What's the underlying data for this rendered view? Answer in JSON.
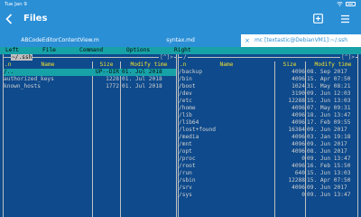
{
  "status": {
    "time": "Tue Jan 9"
  },
  "nav": {
    "title": "Files"
  },
  "tabs": [
    {
      "label": "ABCodeEditorContentView.m"
    },
    {
      "label": "syntax.md"
    },
    {
      "label": "mc [textastic@DebianVM1]:~/.ssh",
      "close": "×"
    }
  ],
  "mc": {
    "menu": [
      "Left",
      "File",
      "Command",
      "Options",
      "Right"
    ],
    "left": {
      "path": "~/.ssh",
      "corner": "[^]>",
      "header": {
        "sort": ".n",
        "name": "Name",
        "size": "Size",
        "time": "Modify time"
      },
      "rows": [
        {
          "name": "/..",
          "size": "UP--DIR",
          "time": "01. Jul 2018",
          "selected": true
        },
        {
          "name": "authorized_keys",
          "size": "1228",
          "time": "01. Jul 2018"
        },
        {
          "name": "known_hosts",
          "size": "1772",
          "time": "01. Jul 2018"
        }
      ]
    },
    "right": {
      "path": "/",
      "corner": "[^]>",
      "header": {
        "sort": ".n",
        "name": "Name",
        "size": "Size",
        "time": "Modify time"
      },
      "rows": [
        {
          "name": "/backup",
          "size": "4096",
          "time": "08. Sep 2017"
        },
        {
          "name": "/bin",
          "size": "4096",
          "time": "15. Apr 07:50"
        },
        {
          "name": "/boot",
          "size": "1024",
          "time": "31. May 08:21"
        },
        {
          "name": "/dev",
          "size": "3190",
          "time": "09. Jun 12:03"
        },
        {
          "name": "/etc",
          "size": "12288",
          "time": "15. Jun 13:03"
        },
        {
          "name": "/home",
          "size": "4096",
          "time": "07. May 09:31"
        },
        {
          "name": "/lib",
          "size": "4096",
          "time": "18. Jun 13:47"
        },
        {
          "name": "/lib64",
          "size": "4096",
          "time": "17. Feb 09:55"
        },
        {
          "name": "/lost+found",
          "size": "16384",
          "time": "09. Jun 2017"
        },
        {
          "name": "/media",
          "size": "4096",
          "time": "03. Jan 19:18"
        },
        {
          "name": "/mnt",
          "size": "4096",
          "time": "09. Jun 2017"
        },
        {
          "name": "/opt",
          "size": "4096",
          "time": "08. Jun 2017"
        },
        {
          "name": "/proc",
          "size": "0",
          "time": "09. Jun 13:47"
        },
        {
          "name": "/root",
          "size": "4096",
          "time": "16. Feb 15:50"
        },
        {
          "name": "/run",
          "size": "640",
          "time": "15. Jun 13:03"
        },
        {
          "name": "/sbin",
          "size": "12288",
          "time": "15. Apr 07:50"
        },
        {
          "name": "/srv",
          "size": "4096",
          "time": "09. Jun 2017"
        },
        {
          "name": "/sys",
          "size": "0",
          "time": "09. Jun 13:47"
        }
      ]
    }
  },
  "colors": {
    "nav_blue": "#2b8fd6",
    "terminal_bg": "#0e4a8c",
    "mc_cyan": "#17a2a8",
    "header_yellow": "#f0e030"
  }
}
